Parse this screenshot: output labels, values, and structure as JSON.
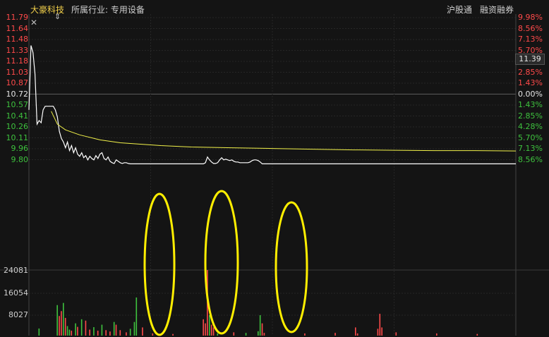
{
  "header": {
    "stock_name": "大豪科技",
    "industry": "所属行业: 专用设备",
    "badge_1": "沪股通",
    "badge_2": "融资融券"
  },
  "current_price": "11.39",
  "colors": {
    "up": "#ff4a4a",
    "down": "#3ec23e",
    "neutral": "#e6e6e6",
    "avg_line": "#f2f24a",
    "annotation": "#ffee00",
    "price_line": "#ffffff"
  },
  "icons": [
    "close-icon",
    "drag-handle-icon"
  ],
  "chart_data": {
    "type": "line",
    "title": "",
    "prev_close": 10.72,
    "ylim": [
      9.73,
      11.79
    ],
    "y_ticks_price": [
      {
        "v": "11.79",
        "c": "up"
      },
      {
        "v": "11.64",
        "c": "up"
      },
      {
        "v": "11.48",
        "c": "up"
      },
      {
        "v": "11.33",
        "c": "up"
      },
      {
        "v": "11.18",
        "c": "up"
      },
      {
        "v": "11.03",
        "c": "up"
      },
      {
        "v": "10.87",
        "c": "up"
      },
      {
        "v": "10.72",
        "c": "neutral"
      },
      {
        "v": "10.57",
        "c": "down"
      },
      {
        "v": "10.41",
        "c": "down"
      },
      {
        "v": "10.26",
        "c": "down"
      },
      {
        "v": "10.11",
        "c": "down"
      },
      {
        "v": "9.96",
        "c": "down"
      },
      {
        "v": "9.80",
        "c": "down"
      }
    ],
    "y_ticks_pct": [
      {
        "v": "9.98%",
        "c": "up"
      },
      {
        "v": "8.56%",
        "c": "up"
      },
      {
        "v": "7.13%",
        "c": "up"
      },
      {
        "v": "5.70%",
        "c": "up"
      },
      {
        "v": "4.28%",
        "c": "up"
      },
      {
        "v": "2.85%",
        "c": "up"
      },
      {
        "v": "1.43%",
        "c": "up"
      },
      {
        "v": "0.00%",
        "c": "neutral"
      },
      {
        "v": "1.43%",
        "c": "down"
      },
      {
        "v": "2.85%",
        "c": "down"
      },
      {
        "v": "4.28%",
        "c": "down"
      },
      {
        "v": "5.70%",
        "c": "down"
      },
      {
        "v": "7.13%",
        "c": "down"
      },
      {
        "v": "8.56%",
        "c": "down"
      }
    ],
    "volume_ticks": [
      "24081",
      "16054",
      "8027"
    ],
    "x_range": [
      0,
      240
    ],
    "series": [
      {
        "role": "price",
        "points": [
          [
            0,
            10.5
          ],
          [
            1,
            11.4
          ],
          [
            2,
            11.3
          ],
          [
            3,
            11.0
          ],
          [
            4,
            10.3
          ],
          [
            5,
            10.35
          ],
          [
            6,
            10.32
          ],
          [
            7,
            10.5
          ],
          [
            8,
            10.55
          ],
          [
            9,
            10.55
          ],
          [
            10,
            10.55
          ],
          [
            11,
            10.55
          ],
          [
            12,
            10.55
          ],
          [
            13,
            10.5
          ],
          [
            14,
            10.4
          ],
          [
            15,
            10.2
          ],
          [
            16,
            10.1
          ],
          [
            17,
            10.05
          ],
          [
            18,
            9.97
          ],
          [
            19,
            10.05
          ],
          [
            20,
            9.93
          ],
          [
            21,
            10.0
          ],
          [
            22,
            9.9
          ],
          [
            23,
            9.97
          ],
          [
            24,
            9.88
          ],
          [
            25,
            9.85
          ],
          [
            26,
            9.9
          ],
          [
            27,
            9.83
          ],
          [
            28,
            9.86
          ],
          [
            29,
            9.8
          ],
          [
            30,
            9.85
          ],
          [
            31,
            9.82
          ],
          [
            32,
            9.8
          ],
          [
            33,
            9.86
          ],
          [
            34,
            9.82
          ],
          [
            35,
            9.88
          ],
          [
            36,
            9.9
          ],
          [
            37,
            9.82
          ],
          [
            38,
            9.8
          ],
          [
            39,
            9.84
          ],
          [
            40,
            9.78
          ],
          [
            41,
            9.76
          ],
          [
            42,
            9.75
          ],
          [
            43,
            9.8
          ],
          [
            44,
            9.78
          ],
          [
            45,
            9.76
          ],
          [
            46,
            9.75
          ],
          [
            47,
            9.76
          ],
          [
            48,
            9.76
          ],
          [
            49,
            9.75
          ],
          [
            50,
            9.745
          ],
          [
            51,
            9.745
          ],
          [
            52,
            9.745
          ],
          [
            53,
            9.745
          ],
          [
            54,
            9.745
          ],
          [
            55,
            9.745
          ],
          [
            56,
            9.745
          ],
          [
            57,
            9.745
          ],
          [
            58,
            9.745
          ],
          [
            59,
            9.745
          ],
          [
            60,
            9.745
          ],
          [
            61,
            9.745
          ],
          [
            62,
            9.745
          ],
          [
            63,
            9.745
          ],
          [
            64,
            9.745
          ],
          [
            65,
            9.745
          ],
          [
            66,
            9.745
          ],
          [
            67,
            9.745
          ],
          [
            68,
            9.745
          ],
          [
            69,
            9.745
          ],
          [
            70,
            9.745
          ],
          [
            71,
            9.745
          ],
          [
            72,
            9.745
          ],
          [
            73,
            9.745
          ],
          [
            74,
            9.745
          ],
          [
            75,
            9.745
          ],
          [
            76,
            9.745
          ],
          [
            77,
            9.745
          ],
          [
            78,
            9.745
          ],
          [
            79,
            9.745
          ],
          [
            80,
            9.745
          ],
          [
            81,
            9.745
          ],
          [
            82,
            9.745
          ],
          [
            83,
            9.745
          ],
          [
            84,
            9.745
          ],
          [
            85,
            9.745
          ],
          [
            86,
            9.745
          ],
          [
            87,
            9.76
          ],
          [
            88,
            9.84
          ],
          [
            89,
            9.8
          ],
          [
            90,
            9.77
          ],
          [
            91,
            9.75
          ],
          [
            92,
            9.75
          ],
          [
            93,
            9.76
          ],
          [
            94,
            9.8
          ],
          [
            95,
            9.83
          ],
          [
            96,
            9.8
          ],
          [
            97,
            9.81
          ],
          [
            98,
            9.8
          ],
          [
            99,
            9.79
          ],
          [
            100,
            9.8
          ],
          [
            101,
            9.78
          ],
          [
            102,
            9.77
          ],
          [
            103,
            9.77
          ],
          [
            104,
            9.76
          ],
          [
            105,
            9.76
          ],
          [
            106,
            9.76
          ],
          [
            107,
            9.76
          ],
          [
            108,
            9.76
          ],
          [
            109,
            9.77
          ],
          [
            110,
            9.79
          ],
          [
            111,
            9.8
          ],
          [
            112,
            9.8
          ],
          [
            113,
            9.79
          ],
          [
            114,
            9.77
          ],
          [
            115,
            9.745
          ],
          [
            116,
            9.745
          ],
          [
            117,
            9.745
          ],
          [
            118,
            9.745
          ],
          [
            119,
            9.745
          ],
          [
            120,
            9.745
          ],
          [
            240,
            9.745
          ]
        ]
      },
      {
        "role": "average",
        "points": [
          [
            11,
            10.48
          ],
          [
            14,
            10.3
          ],
          [
            18,
            10.22
          ],
          [
            25,
            10.15
          ],
          [
            35,
            10.08
          ],
          [
            45,
            10.04
          ],
          [
            55,
            10.02
          ],
          [
            65,
            10.0
          ],
          [
            80,
            9.98
          ],
          [
            100,
            9.97
          ],
          [
            120,
            9.96
          ],
          [
            140,
            9.95
          ],
          [
            160,
            9.94
          ],
          [
            180,
            9.935
          ],
          [
            200,
            9.93
          ],
          [
            220,
            9.93
          ],
          [
            240,
            9.925
          ]
        ]
      }
    ],
    "volume": [
      [
        4,
        2600,
        "down"
      ],
      [
        13,
        11200,
        "down"
      ],
      [
        14,
        7200,
        "up"
      ],
      [
        15,
        9000,
        "up"
      ],
      [
        16,
        12000,
        "down"
      ],
      [
        17,
        6500,
        "up"
      ],
      [
        18,
        3500,
        "down"
      ],
      [
        19,
        2200,
        "down"
      ],
      [
        20,
        1800,
        "up"
      ],
      [
        22,
        4500,
        "down"
      ],
      [
        23,
        3200,
        "up"
      ],
      [
        25,
        6000,
        "down"
      ],
      [
        27,
        5500,
        "up"
      ],
      [
        29,
        2200,
        "up"
      ],
      [
        31,
        3100,
        "down"
      ],
      [
        33,
        1800,
        "up"
      ],
      [
        35,
        4000,
        "down"
      ],
      [
        37,
        2000,
        "up"
      ],
      [
        39,
        1500,
        "up"
      ],
      [
        41,
        5000,
        "down"
      ],
      [
        42,
        4000,
        "up"
      ],
      [
        44,
        2000,
        "up"
      ],
      [
        47,
        1200,
        "up"
      ],
      [
        49,
        2500,
        "down"
      ],
      [
        51,
        5000,
        "down"
      ],
      [
        52,
        14000,
        "down"
      ],
      [
        55,
        3000,
        "up"
      ],
      [
        60,
        800,
        "up"
      ],
      [
        70,
        600,
        "up"
      ],
      [
        85,
        6000,
        "up"
      ],
      [
        86,
        4500,
        "up"
      ],
      [
        87,
        24081,
        "up"
      ],
      [
        88,
        7500,
        "down"
      ],
      [
        89,
        4000,
        "up"
      ],
      [
        90,
        3000,
        "up"
      ],
      [
        92,
        800,
        "down"
      ],
      [
        100,
        1200,
        "up"
      ],
      [
        106,
        1000,
        "down"
      ],
      [
        112,
        1600,
        "down"
      ],
      [
        113,
        7500,
        "down"
      ],
      [
        114,
        4500,
        "up"
      ],
      [
        115,
        1000,
        "up"
      ],
      [
        135,
        800,
        "up"
      ],
      [
        150,
        1000,
        "up"
      ],
      [
        160,
        3000,
        "up"
      ],
      [
        161,
        800,
        "up"
      ],
      [
        171,
        2500,
        "up"
      ],
      [
        172,
        8000,
        "up"
      ],
      [
        173,
        3000,
        "up"
      ],
      [
        180,
        1200,
        "up"
      ],
      [
        200,
        800,
        "up"
      ],
      [
        220,
        600,
        "up"
      ]
    ]
  }
}
